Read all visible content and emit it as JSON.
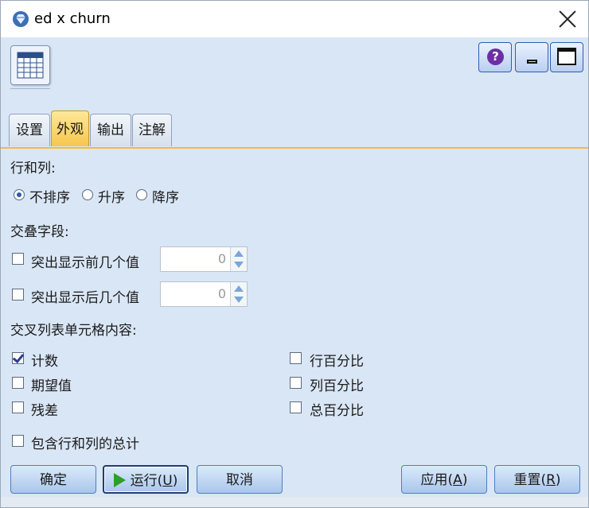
{
  "window": {
    "title": "ed x churn",
    "icon": "diamond-icon",
    "close_icon": "close-icon"
  },
  "header": {
    "node_icon": "table-node-icon",
    "buttons": {
      "help": "help-icon",
      "minimize": "minimize-icon",
      "maximize": "maximize-icon"
    }
  },
  "tabs": [
    {
      "label": "设置",
      "active": false
    },
    {
      "label": "外观",
      "active": true
    },
    {
      "label": "输出",
      "active": false
    },
    {
      "label": "注解",
      "active": false
    }
  ],
  "rows_cols": {
    "heading": "行和列:",
    "options": [
      {
        "label": "不排序",
        "selected": true
      },
      {
        "label": "升序",
        "selected": false
      },
      {
        "label": "降序",
        "selected": false
      }
    ]
  },
  "overlay": {
    "heading": "交叠字段:",
    "top_values": {
      "label": "突出显示前几个值",
      "checked": false,
      "value": "0"
    },
    "bottom_values": {
      "label": "突出显示后几个值",
      "checked": false,
      "value": "0"
    }
  },
  "cell_contents": {
    "heading": "交叉列表单元格内容:",
    "left": [
      {
        "label": "计数",
        "checked": true
      },
      {
        "label": "期望值",
        "checked": false
      },
      {
        "label": "残差",
        "checked": false
      }
    ],
    "right": [
      {
        "label": "行百分比",
        "checked": false
      },
      {
        "label": "列百分比",
        "checked": false
      },
      {
        "label": "总百分比",
        "checked": false
      }
    ]
  },
  "include_totals": {
    "label": "包含行和列的总计",
    "checked": false
  },
  "buttons": {
    "ok": "确定",
    "run": "运行(",
    "run_key": "U",
    "run_close": ")",
    "cancel": "取消",
    "apply": "应用(",
    "apply_key": "A",
    "apply_close": ")",
    "reset": "重置(",
    "reset_key": "R",
    "reset_close": ")"
  },
  "colors": {
    "panel": "#d9e6f5",
    "active_tab": "#f7c64c",
    "button": "#a9c6ea",
    "run_play": "#2aa02a"
  }
}
